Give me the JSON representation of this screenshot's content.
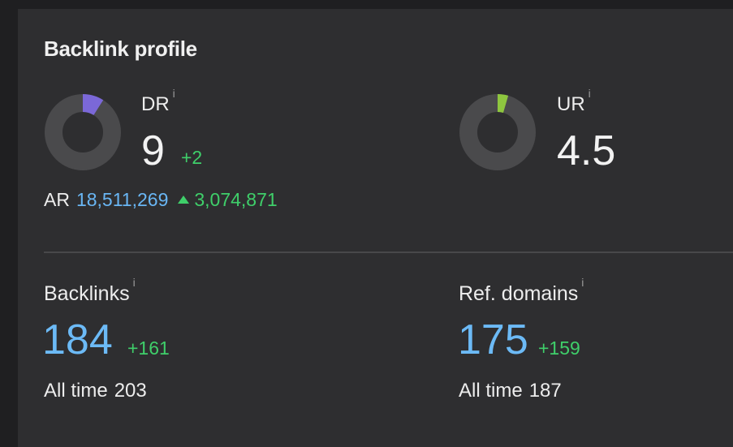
{
  "title": "Backlink profile",
  "info_glyph": "i",
  "dr": {
    "label": "DR",
    "value": "9",
    "delta": "+2",
    "gauge_fraction": 0.09,
    "gauge_color": "#7b68d8"
  },
  "ur": {
    "label": "UR",
    "value": "4.5",
    "gauge_fraction": 0.045,
    "gauge_color": "#8ec63f"
  },
  "ar": {
    "label": "AR",
    "value": "18,511,269",
    "delta": "3,074,871",
    "delta_icon": "triangle-up-icon"
  },
  "backlinks": {
    "label": "Backlinks",
    "value": "184",
    "delta": "+161",
    "alltime_label": "All time",
    "alltime_value": "203"
  },
  "ref_domains": {
    "label": "Ref. domains",
    "value": "175",
    "delta": "+159",
    "alltime_label": "All time",
    "alltime_value": "187"
  },
  "colors": {
    "background": "#1f1f21",
    "card": "#2e2e30",
    "donut_track": "#4a4a4c",
    "positive": "#3fcf6a",
    "link_blue": "#69b6f4"
  }
}
